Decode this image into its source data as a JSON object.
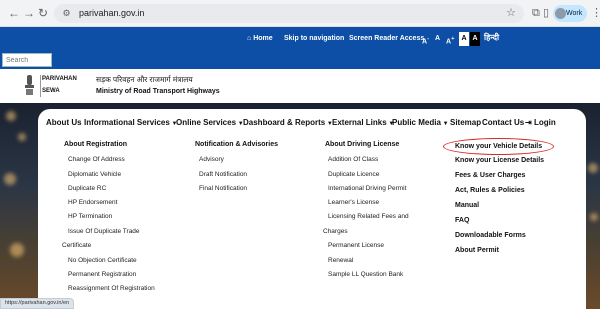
{
  "browser": {
    "url": "parivahan.gov.in",
    "profile_label": "Work",
    "icons": [
      "back-arrow-icon",
      "forward-arrow-icon",
      "reload-icon",
      "site-info-icon",
      "star-icon",
      "extensions-icon",
      "sidepanel-icon",
      "more-icon"
    ]
  },
  "topbar": {
    "home": "Home",
    "skip": "Skip to navigation",
    "screen_reader": "Screen Reader Access",
    "font_a_minus": "A",
    "font_a_minus_sup": "-",
    "font_a": "A",
    "font_a_plus": "A",
    "font_a_plus_sup": "+",
    "contrast_light": "A",
    "contrast_dark": "A",
    "hindi": "हिन्दी"
  },
  "search": {
    "placeholder": "Search"
  },
  "header": {
    "parivahan": "PARIVAHAN",
    "sewa": "SEWA",
    "ministry_hindi": "सड़क परिवहन और राजमार्ग मंत्रालय",
    "ministry_en": "Ministry of Road Transport Highways"
  },
  "menubar": {
    "about_us": "About Us",
    "informational_services": "Informational Services",
    "online_services": "Online Services",
    "dashboard_reports": "Dashboard & Reports",
    "external_links": "External Links",
    "public_media": "Public Media",
    "sitemap": "Sitemap",
    "contact_us": "Contact Us",
    "login": "Login"
  },
  "columns": {
    "registration": {
      "heading": "About Registration",
      "items": [
        "Change Of Address",
        "Diplomatic Vehicle",
        "Duplicate RC",
        "HP Endorsement",
        "HP Termination",
        "Issue Of Duplicate Trade",
        "Certificate",
        "No Objection Certificate",
        "Permanent Registration",
        "Reassignment Of Registration"
      ]
    },
    "notification": {
      "heading": "Notification & Advisories",
      "items": [
        "Advisory",
        "Draft Notification",
        "Final Notification"
      ]
    },
    "driving": {
      "heading": "About Driving License",
      "items": [
        "Addition Of Class",
        "Duplicate Licence",
        "International Driving Permit",
        "Learner's License",
        "Licensing Related Fees and",
        "Charges",
        "Permanent License",
        "Renewal",
        "Sample LL Question Bank"
      ]
    },
    "right": {
      "items": [
        "Know your Vehicle Details",
        "Know your License Details",
        "Fees & User Charges",
        "Act, Rules & Policies",
        "Manual",
        "FAQ",
        "Downloadable Forms",
        "About Permit"
      ]
    }
  },
  "status_url": "https://parivahan.gov.in/en"
}
